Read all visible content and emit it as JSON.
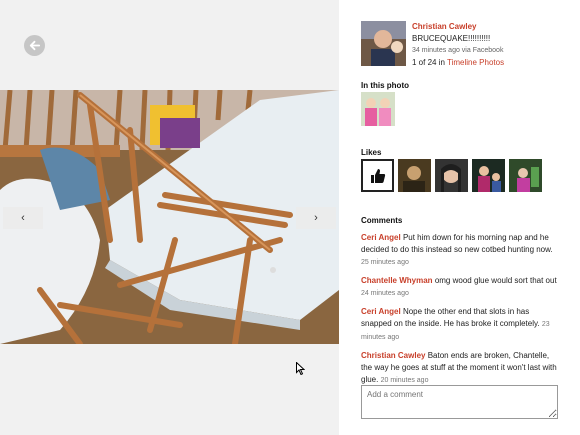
{
  "post": {
    "author": "Christian Cawley",
    "text": "BRUCEQUAKE!!!!!!!!!!",
    "meta": "34 minutes ago via Facebook",
    "position_prefix": "1 of 24 in",
    "album": "Timeline Photos"
  },
  "in_this_photo": {
    "title": "In this photo"
  },
  "likes": {
    "title": "Likes",
    "count_shown": 5
  },
  "comments": {
    "title": "Comments",
    "items": [
      {
        "author": "Ceri Angel",
        "text": "Put him down for his morning nap and he decided to do this instead so new cotbed hunting now.",
        "time": "25 minutes ago"
      },
      {
        "author": "Chantelle Whyman",
        "text": "omg wood glue would sort that out",
        "time": "24 minutes ago"
      },
      {
        "author": "Ceri Angel",
        "text": "Nope the other end that slots in has snapped on the inside. He has broke it completely.",
        "time": "23 minutes ago"
      },
      {
        "author": "Christian Cawley",
        "text": "Baton ends are broken, Chantelle, the way he goes at stuff at the moment it won't last with glue.",
        "time": "20 minutes ago"
      }
    ],
    "input_placeholder": "Add a comment"
  },
  "viewer": {
    "prev_label": "‹",
    "next_label": "›"
  },
  "colors": {
    "accent": "#c8402b",
    "viewer_bg": "#f1f1f1"
  }
}
